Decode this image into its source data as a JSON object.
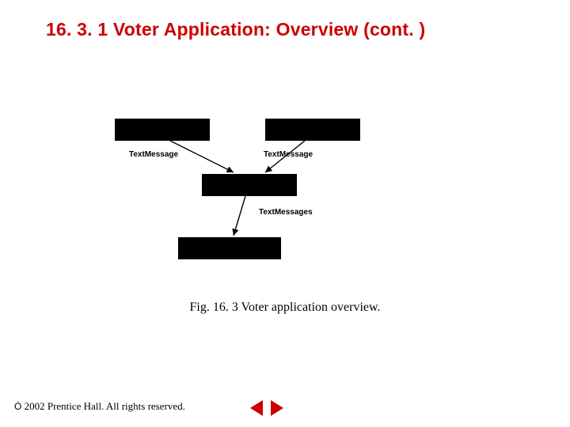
{
  "title": "16. 3. 1   Voter Application: Overview (cont. )",
  "diagram": {
    "labels": {
      "tm1": "TextMessage",
      "tm2": "TextMessage",
      "tm3": "TextMessages"
    }
  },
  "caption": "Fig. 16. 3   Voter application overview.",
  "footer": {
    "copy_symbol": "Ó",
    "text": " 2002 Prentice Hall. All rights reserved."
  }
}
